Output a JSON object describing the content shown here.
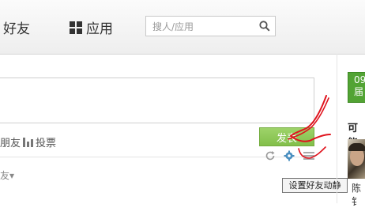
{
  "topbar": {
    "friends_label": "好友",
    "apps_label": "应用",
    "search_placeholder": "搜人/应用"
  },
  "composer": {
    "friend_option_label": "朋友",
    "poll_option_label": "投票",
    "post_button_label": "发表",
    "friends_filter_label": "友▾",
    "tooltip": "设置好友动静"
  },
  "sidebar": {
    "badge_top": "09",
    "badge_bottom": "届",
    "maybe_know_title": "可能",
    "person_name": "陈钅"
  },
  "colors": {
    "accent_green": "#82bf4a",
    "annotation_red": "#e0141e"
  }
}
